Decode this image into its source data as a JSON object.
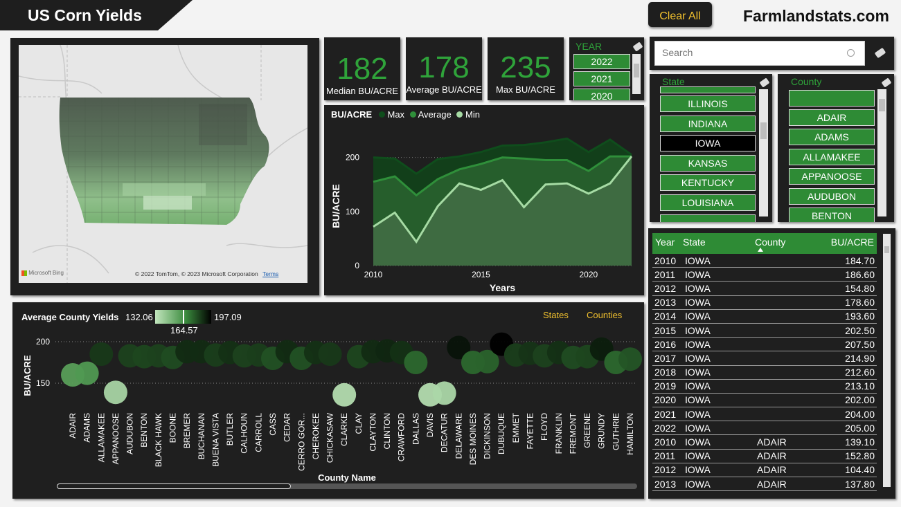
{
  "header": {
    "title": "US Corn Yields",
    "clear_all": "Clear All",
    "brand": "Farmlandstats.com"
  },
  "map": {
    "attribution": "© 2022 TomTom, © 2023 Microsoft Corporation",
    "terms": "Terms",
    "provider": "Microsoft Bing"
  },
  "kpis": [
    {
      "value": "182",
      "label": "Median BU/ACRE"
    },
    {
      "value": "178",
      "label": "Average BU/ACRE"
    },
    {
      "value": "235",
      "label": "Max BU/ACRE"
    }
  ],
  "year_slicer": {
    "title": "YEAR",
    "items": [
      "2022",
      "2021",
      "2020"
    ]
  },
  "search": {
    "placeholder": "Search"
  },
  "state_slicer": {
    "title": "State",
    "items": [
      "ILLINOIS",
      "INDIANA",
      "IOWA",
      "KANSAS",
      "KENTUCKY",
      "LOUISIANA"
    ],
    "selected": "IOWA"
  },
  "county_slicer": {
    "title": "County",
    "items": [
      "",
      "ADAIR",
      "ADAMS",
      "ALLAMAKEE",
      "APPANOOSE",
      "AUDUBON",
      "BENTON"
    ]
  },
  "line_chart": {
    "title": "BU/ACRE",
    "legend": [
      "Max",
      "Average",
      "Min"
    ],
    "colors": {
      "max": "#0f4d1c",
      "average": "#2f8f3a",
      "min": "#a6dba4"
    },
    "xlabel": "Years",
    "ylabel": "BU/ACRE",
    "x_ticks": [
      "2010",
      "2015",
      "2020"
    ],
    "y_ticks": [
      "0",
      "100",
      "200"
    ]
  },
  "chart_data": [
    {
      "type": "area",
      "title": "BU/ACRE",
      "xlabel": "Years",
      "ylabel": "BU/ACRE",
      "xlim": [
        2010,
        2022
      ],
      "ylim": [
        0,
        235
      ],
      "x": [
        2010,
        2011,
        2012,
        2013,
        2014,
        2015,
        2016,
        2017,
        2018,
        2019,
        2020,
        2021,
        2022
      ],
      "series": [
        {
          "name": "Max",
          "values": [
            200,
            198,
            170,
            197,
            202,
            210,
            222,
            223,
            228,
            235,
            210,
            233,
            205
          ]
        },
        {
          "name": "Average",
          "values": [
            155,
            165,
            130,
            160,
            178,
            188,
            200,
            198,
            195,
            195,
            175,
            202,
            202
          ]
        },
        {
          "name": "Min",
          "values": [
            72,
            98,
            44,
            110,
            152,
            140,
            158,
            108,
            150,
            152,
            133,
            152,
            202
          ]
        }
      ],
      "grid": true,
      "legend": "top-left"
    },
    {
      "type": "scatter",
      "title": "Average County Yields",
      "xlabel": "County Name",
      "ylabel": "BU/ACRE",
      "color_scale": {
        "min": "132.06",
        "mid": "164.57",
        "max": "197.09"
      },
      "ylim": [
        130,
        205
      ],
      "y_ticks": [
        "150",
        "200"
      ],
      "categories": [
        "ADAIR",
        "ADAMS",
        "ALLAMAKEE",
        "APPANOOSE",
        "AUDUBON",
        "BENTON",
        "BLACK HAWK",
        "BOONE",
        "BREMER",
        "BUCHANAN",
        "BUENA VISTA",
        "BUTLER",
        "CALHOUN",
        "CARROLL",
        "CASS",
        "CEDAR",
        "CERRO GOR...",
        "CHEROKEE",
        "CHICKASAW",
        "CLARKE",
        "CLAY",
        "CLAYTON",
        "CLINTON",
        "CRAWFORD",
        "DALLAS",
        "DAVIS",
        "DECATUR",
        "DELAWARE",
        "DES MOINES",
        "DICKINSON",
        "DUBUQUE",
        "EMMET",
        "FAYETTE",
        "FLOYD",
        "FRANKLIN",
        "FREMONT",
        "GREENE",
        "GRUNDY",
        "GUTHRIE",
        "HAMILTON"
      ],
      "values": [
        160,
        162,
        185,
        139,
        183,
        182,
        183,
        181,
        188,
        188,
        184,
        187,
        183,
        184,
        180,
        188,
        180,
        187,
        185,
        136,
        182,
        188,
        189,
        187,
        175,
        136,
        138,
        193,
        175,
        176,
        197,
        184,
        186,
        183,
        187,
        181,
        182,
        191,
        175,
        179
      ]
    }
  ],
  "bubble_chart": {
    "title": "Average County Yields",
    "scale_min": "132.06",
    "scale_max": "197.09",
    "scale_mid": "164.57",
    "tab_states": "States",
    "tab_counties": "Counties",
    "xlabel": "County Name",
    "ylabel": "BU/ACRE"
  },
  "table": {
    "headers": [
      "Year",
      "State",
      "County",
      "BU/ACRE"
    ],
    "rows": [
      [
        "2010",
        "IOWA",
        "",
        "184.70"
      ],
      [
        "2011",
        "IOWA",
        "",
        "186.60"
      ],
      [
        "2012",
        "IOWA",
        "",
        "154.80"
      ],
      [
        "2013",
        "IOWA",
        "",
        "178.60"
      ],
      [
        "2014",
        "IOWA",
        "",
        "193.60"
      ],
      [
        "2015",
        "IOWA",
        "",
        "202.50"
      ],
      [
        "2016",
        "IOWA",
        "",
        "207.50"
      ],
      [
        "2017",
        "IOWA",
        "",
        "214.90"
      ],
      [
        "2018",
        "IOWA",
        "",
        "212.60"
      ],
      [
        "2019",
        "IOWA",
        "",
        "213.10"
      ],
      [
        "2020",
        "IOWA",
        "",
        "202.00"
      ],
      [
        "2021",
        "IOWA",
        "",
        "204.00"
      ],
      [
        "2022",
        "IOWA",
        "",
        "205.00"
      ],
      [
        "2010",
        "IOWA",
        "ADAIR",
        "139.10"
      ],
      [
        "2011",
        "IOWA",
        "ADAIR",
        "152.80"
      ],
      [
        "2012",
        "IOWA",
        "ADAIR",
        "104.40"
      ],
      [
        "2013",
        "IOWA",
        "ADAIR",
        "137.80"
      ]
    ]
  }
}
